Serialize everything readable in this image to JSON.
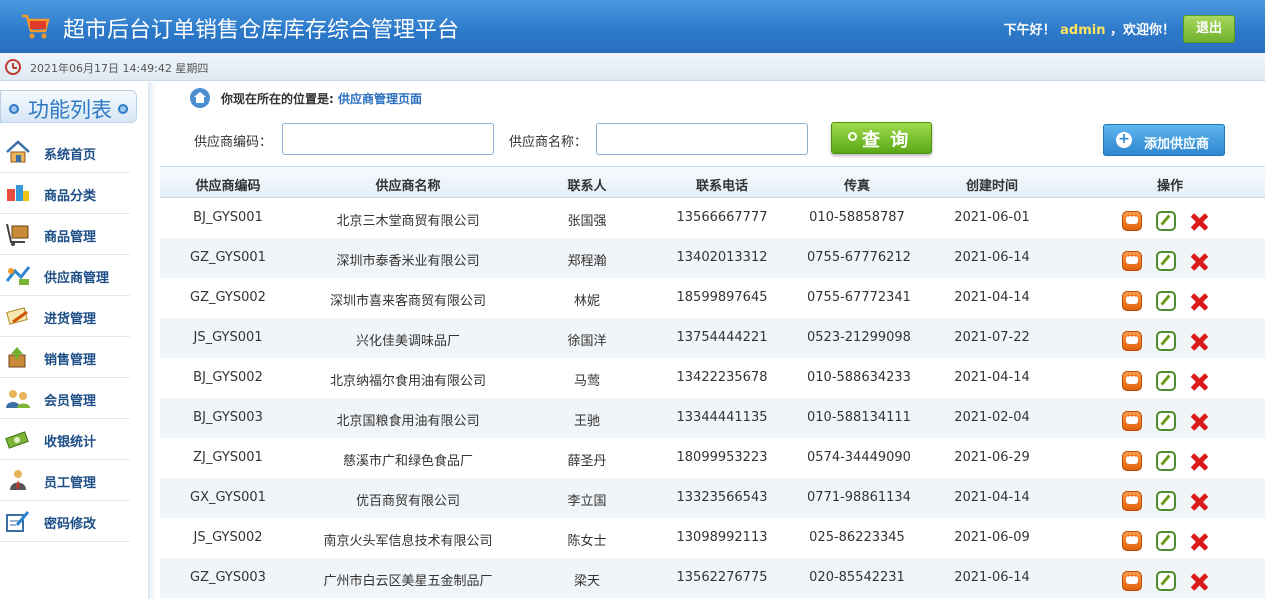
{
  "header": {
    "title": "超市后台订单销售仓库库存综合管理平台",
    "greeting_prefix": "下午好！",
    "username": "admin",
    "greeting_suffix": "，欢迎你！",
    "logout_label": "退出"
  },
  "datebar": {
    "datetime": "2021年06月17日 14:49:42 星期四"
  },
  "sidebar": {
    "title": "功能列表",
    "items": [
      {
        "label": "系统首页",
        "icon": "home-icon"
      },
      {
        "label": "商品分类",
        "icon": "category-icon"
      },
      {
        "label": "商品管理",
        "icon": "goods-icon"
      },
      {
        "label": "供应商管理",
        "icon": "supplier-icon"
      },
      {
        "label": "进货管理",
        "icon": "purchase-icon"
      },
      {
        "label": "销售管理",
        "icon": "sales-icon"
      },
      {
        "label": "会员管理",
        "icon": "member-icon"
      },
      {
        "label": "收银统计",
        "icon": "cash-icon"
      },
      {
        "label": "员工管理",
        "icon": "staff-icon"
      },
      {
        "label": "密码修改",
        "icon": "password-icon"
      }
    ]
  },
  "breadcrumb": {
    "prefix": "你现在所在的位置是:",
    "current": "供应商管理页面"
  },
  "search": {
    "code_label": "供应商编码：",
    "code_value": "",
    "name_label": "供应商名称：",
    "name_value": "",
    "query_label": "查 询",
    "add_label": "添加供应商"
  },
  "table": {
    "columns": [
      "供应商编码",
      "供应商名称",
      "联系人",
      "联系电话",
      "传真",
      "创建时间",
      "操作"
    ],
    "rows": [
      [
        "BJ_GYS001",
        "北京三木堂商贸有限公司",
        "张国强",
        "13566667777",
        "010-58858787",
        "2021-06-01"
      ],
      [
        "GZ_GYS001",
        "深圳市泰香米业有限公司",
        "郑程瀚",
        "13402013312",
        "0755-67776212",
        "2021-06-14"
      ],
      [
        "GZ_GYS002",
        "深圳市喜来客商贸有限公司",
        "林妮",
        "18599897645",
        "0755-67772341",
        "2021-04-14"
      ],
      [
        "JS_GYS001",
        "兴化佳美调味品厂",
        "徐国洋",
        "13754444221",
        "0523-21299098",
        "2021-07-22"
      ],
      [
        "BJ_GYS002",
        "北京纳福尔食用油有限公司",
        "马莺",
        "13422235678",
        "010-588634233",
        "2021-04-14"
      ],
      [
        "BJ_GYS003",
        "北京国粮食用油有限公司",
        "王驰",
        "13344441135",
        "010-588134111",
        "2021-02-04"
      ],
      [
        "ZJ_GYS001",
        "慈溪市广和绿色食品厂",
        "薛圣丹",
        "18099953223",
        "0574-34449090",
        "2021-06-29"
      ],
      [
        "GX_GYS001",
        "优百商贸有限公司",
        "李立国",
        "13323566543",
        "0771-98861134",
        "2021-04-14"
      ],
      [
        "JS_GYS002",
        "南京火头军信息技术有限公司",
        "陈女士",
        "13098992113",
        "025-86223345",
        "2021-06-09"
      ],
      [
        "GZ_GYS003",
        "广州市白云区美星五金制品厂",
        "梁天",
        "13562276775",
        "020-85542231",
        "2021-06-14"
      ]
    ]
  },
  "colors": {
    "header_blue": "#2c78c9",
    "link_blue": "#2a6fbe",
    "query_green": "#5ba815",
    "add_blue": "#2e86d0",
    "delete_red": "#d91b1b"
  }
}
